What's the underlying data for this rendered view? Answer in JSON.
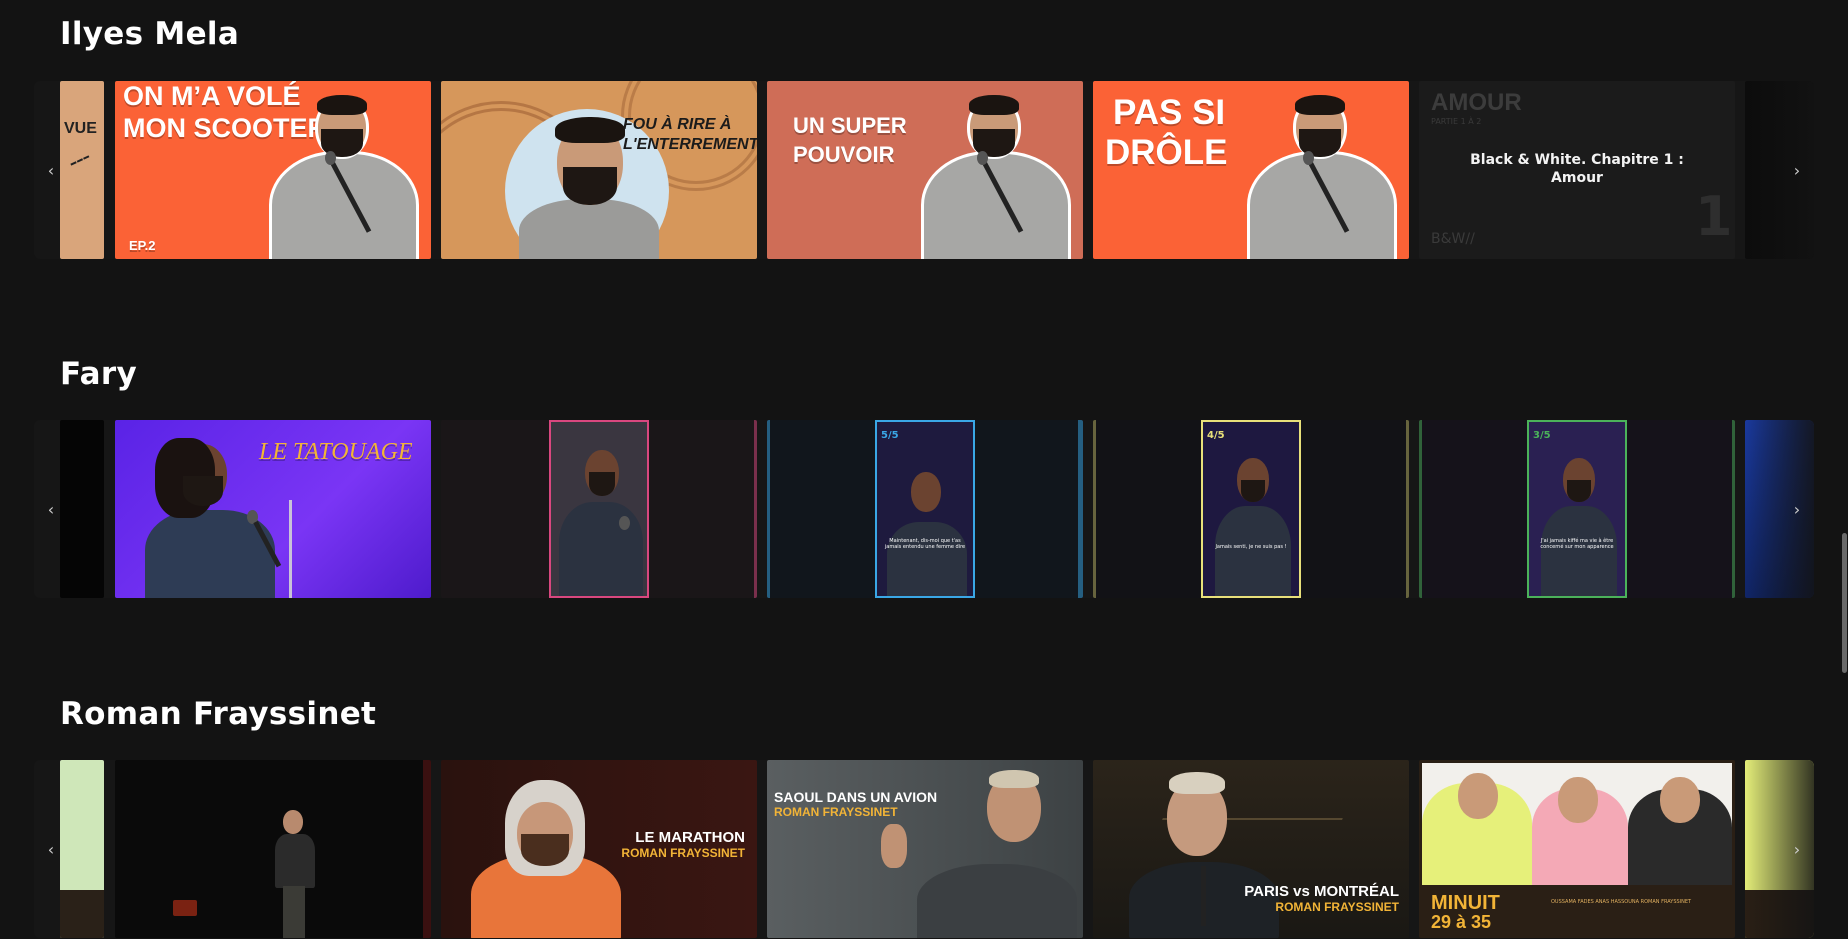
{
  "rows": [
    {
      "title": "Ilyes Mela",
      "cards": [
        {
          "type": "partial",
          "text": "VUE"
        },
        {
          "type": "thumb",
          "text_line1": "ON M’A VOLÉ",
          "text_line2": "MON SCOOTER",
          "badge": "EP.2"
        },
        {
          "type": "thumb",
          "text_line1": "FOU À RIRE À",
          "text_line2": "L'ENTERREMENT"
        },
        {
          "type": "thumb",
          "text_line1": "UN SUPER",
          "text_line2": "POUVOIR"
        },
        {
          "type": "thumb",
          "text_line1": "PAS SI",
          "text_line2": "DRÔLE"
        },
        {
          "type": "caption",
          "caption": "Black & White. Chapitre 1 : Amour",
          "bg_title": "AMOUR",
          "bg_sub": "PARTIE 1 À 2",
          "bg_logo": "B&W//",
          "bg_number": "1"
        }
      ]
    },
    {
      "title": "Fary",
      "cards": [
        {
          "type": "thumb",
          "text_line1": "LE TATOUAGE"
        },
        {
          "type": "vertical",
          "label": "",
          "sub": ""
        },
        {
          "type": "vertical",
          "label": "5/5",
          "sub": "Maintenant, dis-moi que t'as jamais entendu une femme dire"
        },
        {
          "type": "vertical",
          "label": "4/5",
          "sub": "Jamais senti, je ne suis pas !"
        },
        {
          "type": "vertical",
          "label": "3/5",
          "sub": "J'ai jamais kiffé ma vie à être concerné sur mon apparence"
        }
      ]
    },
    {
      "title": "Roman Frayssinet",
      "cards": [
        {
          "type": "stage"
        },
        {
          "type": "poster",
          "title": "LE MARATHON",
          "subtitle": "ROMAN FRAYSSINET"
        },
        {
          "type": "poster",
          "title": "SAOUL DANS UN AVION",
          "subtitle": "ROMAN FRAYSSINET"
        },
        {
          "type": "poster",
          "title": "PARIS vs MONTRÉAL",
          "subtitle": "ROMAN FRAYSSINET"
        },
        {
          "type": "poster",
          "title": "MINUIT",
          "subtitle": "29 à 35",
          "credits": "OUSSAMA FADES  ANAS HASSOUNA  ROMAN FRAYSSINET"
        }
      ]
    }
  ],
  "icons": {
    "prev": "‹",
    "next": "›"
  },
  "colors": {
    "background": "#131313",
    "orange": "#fb6236",
    "tan": "#d6975b",
    "salmon": "#cf6d57",
    "purple": "#6b2df0",
    "pink_frame": "#d9477f",
    "blue_frame": "#3aa7e6",
    "yellow_frame": "#e8e07a",
    "green_frame": "#4bb25a",
    "gold": "#f2b437"
  }
}
